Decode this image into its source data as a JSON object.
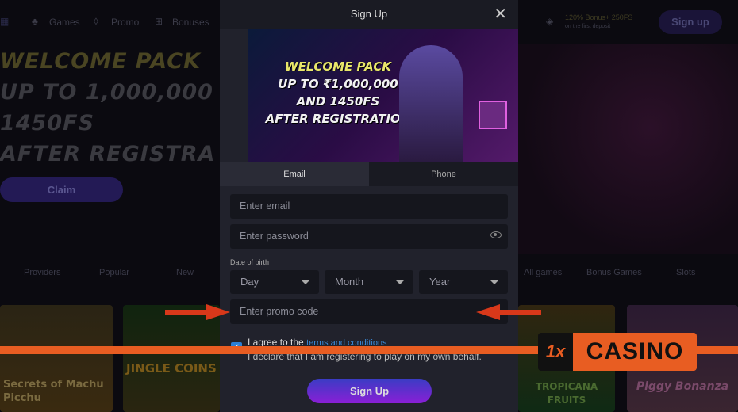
{
  "background": {
    "nav": {
      "games": "Games",
      "promo": "Promo",
      "bonuses": "Bonuses",
      "bonus_title": "120% Bonus+ 250FS",
      "bonus_sub": "on the first deposit",
      "signup": "Sign up"
    },
    "hero": {
      "line1": "WELCOME PACK",
      "line2": "UP TO 1,000,000",
      "line3": "1450FS",
      "line4": "AFTER REGISTRA",
      "claim": "Claim"
    },
    "categories": [
      "Providers",
      "Popular",
      "New",
      "All games",
      "Bonus Games",
      "Slots"
    ],
    "tiles": [
      "Secrets of Machu Picchu",
      "Jingle Coins",
      "Tropicana Fruits",
      "Piggy Bonanza"
    ]
  },
  "modal": {
    "title": "Sign Up",
    "banner": {
      "line1": "WELCOME PACK",
      "line2": "UP TO ₹1,000,000",
      "line3": "AND 1450FS",
      "line4": "AFTER REGISTRATION"
    },
    "tabs": [
      {
        "label": "Email",
        "active": true
      },
      {
        "label": "Phone",
        "active": false
      }
    ],
    "email_placeholder": "Enter email",
    "password_placeholder": "Enter password",
    "dob_label": "Date of birth",
    "day": "Day",
    "month": "Month",
    "year": "Year",
    "promo_placeholder": "Enter promo code",
    "agree_prefix": "I agree to the",
    "terms_link": "terms and conditions",
    "declare": "I declare that I am registering to play on my own behalf.",
    "submit": "Sign Up",
    "checkbox_checked": true
  },
  "watermark": {
    "logo_mark": "1x",
    "logo_text": "CASINO",
    "color": "#e85d22"
  }
}
